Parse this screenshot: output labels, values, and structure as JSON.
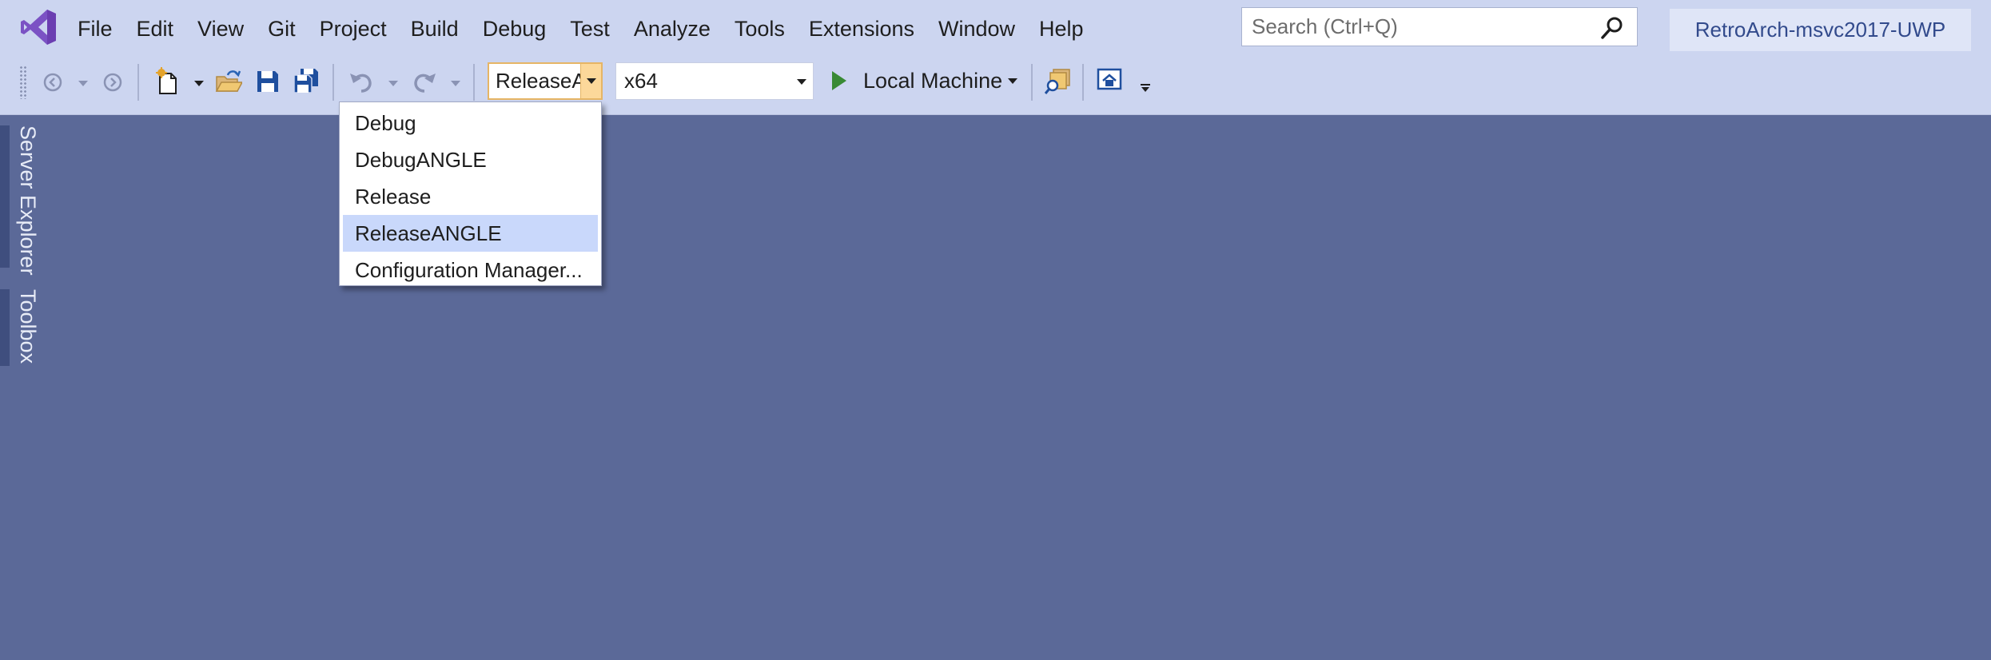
{
  "app": {
    "logo_icon": "visual-studio-logo-icon",
    "solution_title": "RetroArch-msvc2017-UWP"
  },
  "menu": {
    "items": [
      {
        "label": "File"
      },
      {
        "label": "Edit"
      },
      {
        "label": "View"
      },
      {
        "label": "Git"
      },
      {
        "label": "Project"
      },
      {
        "label": "Build"
      },
      {
        "label": "Debug"
      },
      {
        "label": "Test"
      },
      {
        "label": "Analyze"
      },
      {
        "label": "Tools"
      },
      {
        "label": "Extensions"
      },
      {
        "label": "Window"
      },
      {
        "label": "Help"
      }
    ]
  },
  "search": {
    "placeholder": "Search (Ctrl+Q)",
    "value": "",
    "icon": "search-icon"
  },
  "toolbar": {
    "configuration": {
      "value": "ReleaseANGLE",
      "options": [
        {
          "label": "Debug"
        },
        {
          "label": "DebugANGLE"
        },
        {
          "label": "Release"
        },
        {
          "label": "ReleaseANGLE"
        },
        {
          "label": "Configuration Manager..."
        }
      ],
      "selected_index": 3,
      "open": true
    },
    "platform": {
      "value": "x64"
    },
    "run_target": {
      "label": "Local Machine"
    }
  },
  "side_tabs": [
    {
      "label": "Server Explorer"
    },
    {
      "label": "Toolbox"
    }
  ],
  "colors": {
    "background": "#5b6998",
    "chrome": "#ccd5f0",
    "accent_purple": "#68217a",
    "combo_highlight": "#fcd89a",
    "selected_item": "#c9d8fb",
    "play_green": "#388a34",
    "title_text": "#324a8c"
  }
}
